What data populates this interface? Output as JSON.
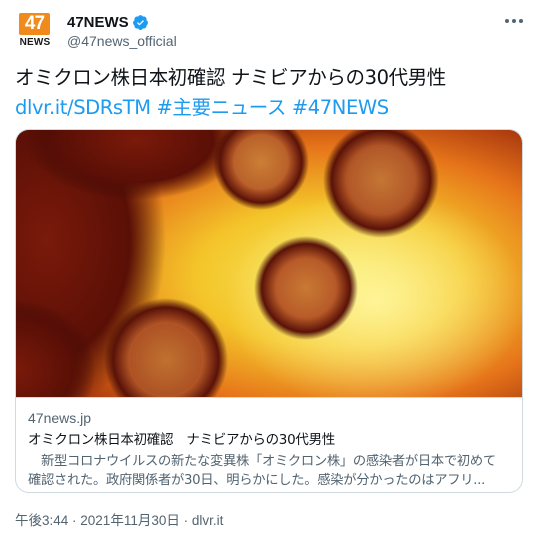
{
  "account": {
    "logo_number": "47",
    "logo_text": "NEWS",
    "display_name": "47NEWS",
    "handle": "@47news_official"
  },
  "tweet": {
    "line1": "オミクロン株日本初確認 ナミビアからの30代男性",
    "link": "dlvr.it/SDRsTM",
    "hashtag1": "#主要ニュース",
    "hashtag2": "#47NEWS"
  },
  "card": {
    "domain": "47news.jp",
    "title": "オミクロン株日本初確認　ナミビアからの30代男性",
    "desc_line1": "　新型コロナウイルスの新たな変異株「オミクロン株」の感染者が日本で初めて",
    "desc_line2": "確認された。政府関係者が30日、明らかにした。感染が分かったのはアフリ..."
  },
  "meta": {
    "time": "午後3:44",
    "separator": " · ",
    "date": "2021年11月30日",
    "source": "dlvr.it"
  },
  "colors": {
    "link_blue": "#1d9bf0",
    "secondary_text": "#536471",
    "logo_orange": "#f08a1c",
    "border": "#cfd9de"
  },
  "icons": [
    "verified-badge-icon",
    "more-options-icon"
  ]
}
